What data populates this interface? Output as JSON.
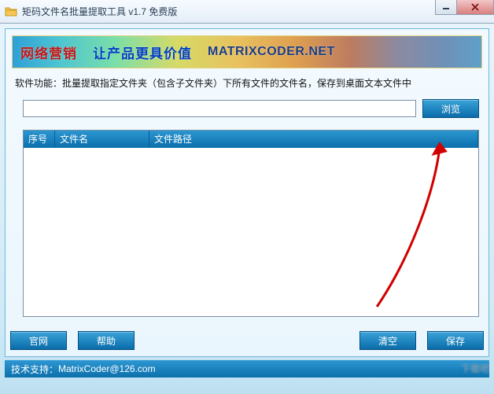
{
  "window": {
    "title": "矩码文件名批量提取工具 v1.7 免费版"
  },
  "banner": {
    "part1": "网络营销",
    "part2": "让产品更具价值",
    "part3": "MATRIXCODER.NET"
  },
  "desc": {
    "label": "软件功能：",
    "text": "批量提取指定文件夹（包含子文件夹）下所有文件的文件名，保存到桌面文本文件中"
  },
  "path": {
    "value": "",
    "placeholder": ""
  },
  "buttons": {
    "browse": "浏览",
    "website": "官网",
    "help": "帮助",
    "clear": "清空",
    "save": "保存"
  },
  "grid": {
    "col_index": "序号",
    "col_name": "文件名",
    "col_path": "文件路径"
  },
  "footer": {
    "label": "技术支持：",
    "email": "MatrixCoder@126.com"
  }
}
